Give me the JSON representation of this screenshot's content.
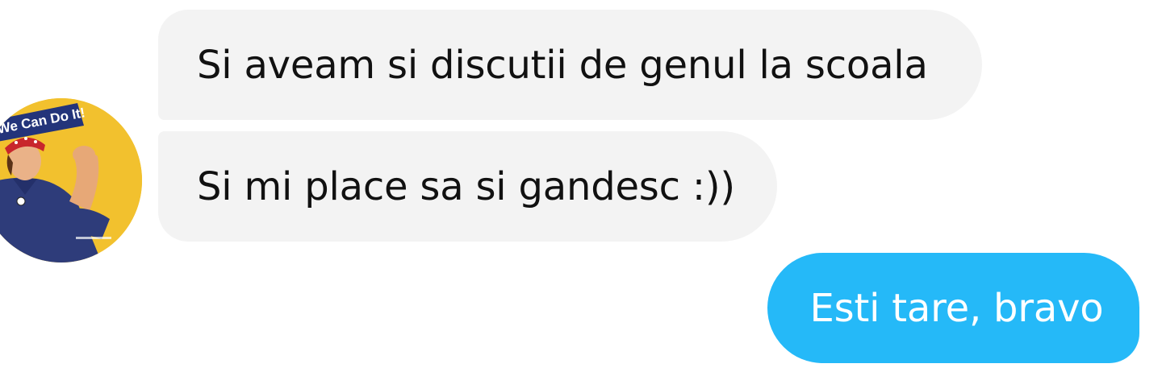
{
  "conversation": {
    "contact": {
      "avatar_icon": "we-can-do-it-poster-avatar",
      "avatar_text": "We Can Do It!"
    },
    "messages": [
      {
        "direction": "incoming",
        "text": "Si aveam si discutii de genul la scoala"
      },
      {
        "direction": "incoming",
        "text": "Si mi place sa si gandesc :))"
      },
      {
        "direction": "outgoing",
        "text": "Esti tare, bravo"
      }
    ],
    "colors": {
      "incoming_bubble": "#f3f3f3",
      "outgoing_bubble": "#25b9f8",
      "incoming_text": "#111111",
      "outgoing_text": "#ffffff"
    }
  }
}
